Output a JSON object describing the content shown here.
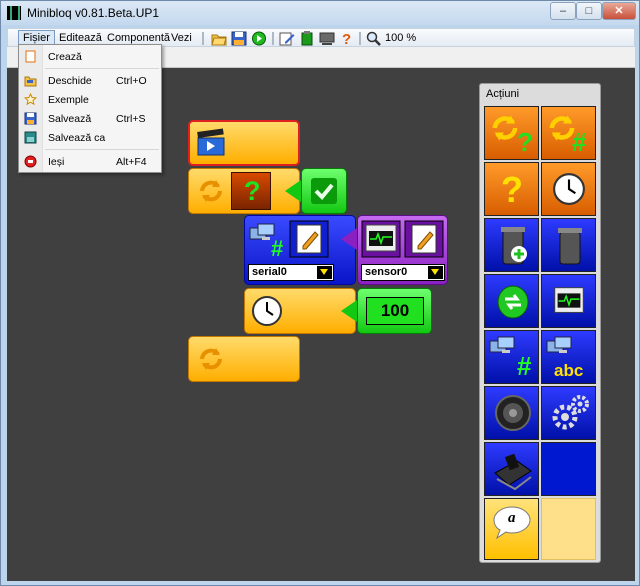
{
  "window": {
    "title": "Minibloq v0.81.Beta.UP1",
    "controls": {
      "minimize": "–",
      "maximize": "□",
      "close": "✕"
    }
  },
  "menubar": {
    "items": [
      {
        "label": "Fișier"
      },
      {
        "label": "Editează"
      },
      {
        "label": "Componentă"
      },
      {
        "label": "Vezi"
      }
    ]
  },
  "toolbar": {
    "zoom": "100 %",
    "tools": [
      "open-folder-icon",
      "save-icon",
      "run-icon",
      "edit-icon",
      "component-icon",
      "board-icon",
      "help-icon",
      "zoom-icon"
    ]
  },
  "file_menu": {
    "items": [
      {
        "label": "Crează",
        "shortcut": ""
      },
      {
        "label": "Deschide",
        "shortcut": "Ctrl+O"
      },
      {
        "label": "Exemple",
        "shortcut": ""
      },
      {
        "label": "Salvează",
        "shortcut": "Ctrl+S"
      },
      {
        "label": "Salvează ca",
        "shortcut": ""
      },
      {
        "label": "Ieși",
        "shortcut": "Alt+F4"
      }
    ]
  },
  "program": {
    "serial_port": "serial0",
    "sensor": "sensor0",
    "delay_value": "100",
    "glyphs": {
      "question": "?",
      "hash": "#"
    }
  },
  "actions_panel": {
    "title": "Acțiuni",
    "glyphs": {
      "question": "?",
      "hash": "#",
      "abc": "abc",
      "alpha": "a"
    }
  },
  "colors": {
    "canvas": "#404040",
    "block_orange": "#ffae00",
    "block_blue": "#0a14c8",
    "block_purple": "#8a1fc2",
    "block_green": "#12c812"
  }
}
